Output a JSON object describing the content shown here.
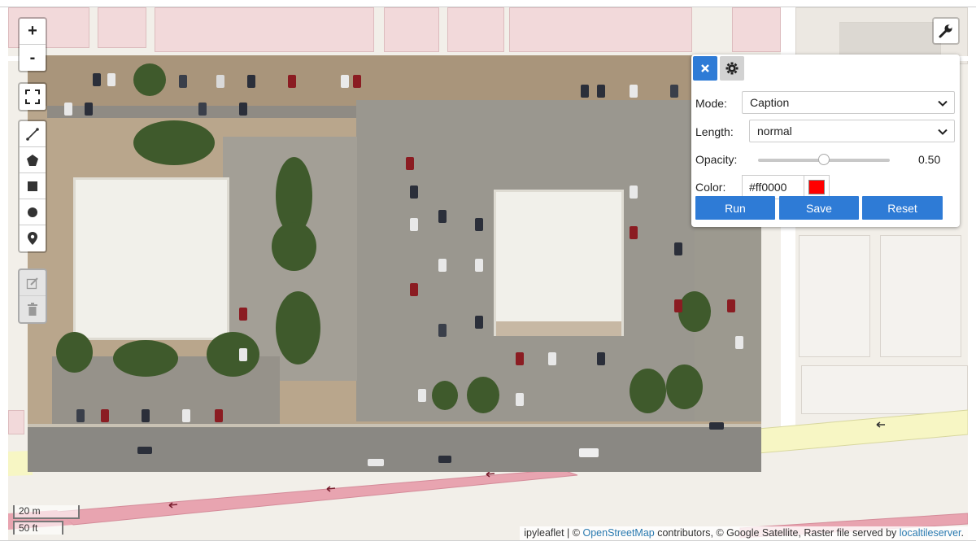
{
  "zoom": {
    "in_label": "+",
    "out_label": "-"
  },
  "draw_tools": {
    "icons": [
      "polyline-icon",
      "polygon-icon",
      "rectangle-icon",
      "circle-icon",
      "marker-icon"
    ],
    "edit_icons": [
      "edit-icon",
      "trash-icon"
    ]
  },
  "toolbar": {
    "wrench_icon": "wrench-icon"
  },
  "panel": {
    "close_icon": "close-icon",
    "settings_icon": "gear-icon",
    "mode": {
      "label": "Mode:",
      "value": "Caption"
    },
    "length": {
      "label": "Length:",
      "value": "normal"
    },
    "opacity": {
      "label": "Opacity:",
      "value": "0.50",
      "fraction": 0.5
    },
    "color": {
      "label": "Color:",
      "value": "#ff0000",
      "swatch": "#ff0000"
    },
    "buttons": {
      "run": "Run",
      "save": "Save",
      "reset": "Reset"
    },
    "accent": "#2e7bd6"
  },
  "scale": {
    "metric": "20 m",
    "imperial": "50 ft"
  },
  "attribution": {
    "prefix": "ipyleaflet | ©",
    "osm_link": "OpenStreetMap",
    "middle": "contributors, © Google Satellite, Raster file served by",
    "server_link": "localtileserver",
    "suffix": "."
  }
}
